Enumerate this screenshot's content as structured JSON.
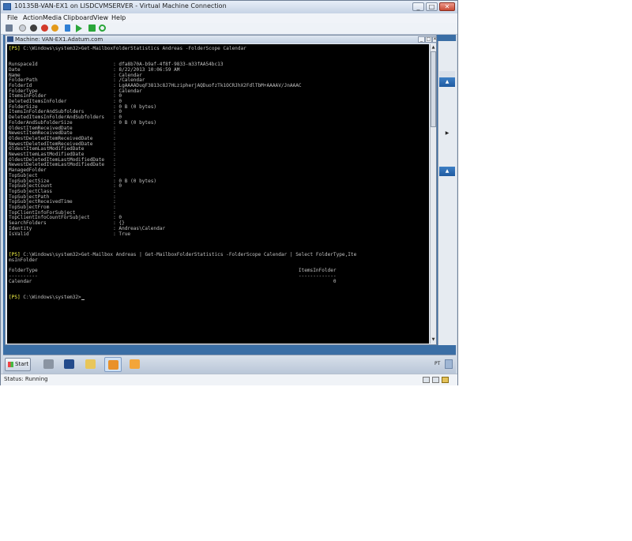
{
  "window": {
    "title": "10135B-VAN-EX1 on LISDCVMSERVER - Virtual Machine Connection",
    "controls": [
      "_",
      "□",
      "✕"
    ]
  },
  "menu": [
    "File",
    "Action",
    "Media",
    "Clipboard",
    "View",
    "Help"
  ],
  "toolbar_icons": [
    "ctrl-alt-del-icon",
    "start-icon",
    "turn-off-icon",
    "shutdown-icon",
    "save-icon",
    "pause-icon",
    "resume-icon",
    "checkpoint-icon",
    "revert-icon"
  ],
  "powershell_window": {
    "title": "Machine: VAN-EX1.Adatum.com",
    "controls": [
      "_",
      "□",
      "✕"
    ]
  },
  "console": {
    "lines": [
      {
        "prompt": "[PS]",
        "text": " C:\\Windows\\system32>Get-MailboxFolderStatistics Andreas -FolderScope Calendar"
      },
      {
        "text": ""
      },
      {
        "text": ""
      },
      {
        "text": "RunspaceId                          : dfa8b70A-b9af-4f8f-9833-m33fAA54bc13"
      },
      {
        "text": "Date                                : 8/22/2013 10:06:59 AM"
      },
      {
        "text": "Name                                : Calendar"
      },
      {
        "text": "FolderPath                          : /Calendar"
      },
      {
        "text": "FolderId                            : LgAAAADuqF3813c8J7HLzipherjAQDuofzTk1OCRJhX2FdlTbM+AAAAV/JnAAAC"
      },
      {
        "text": "FolderType                          : Calendar"
      },
      {
        "text": "ItemsInFolder                       : 0"
      },
      {
        "text": "DeletedItemsInFolder                : 0"
      },
      {
        "text": "FolderSize                          : 0 B (0 bytes)"
      },
      {
        "text": "ItemsInFolderAndSubfolders          : 0"
      },
      {
        "text": "DeletedItemsInFolderAndSubfolders   : 0"
      },
      {
        "text": "FolderAndSubfolderSize              : 0 B (0 bytes)"
      },
      {
        "text": "OldestItemReceivedDate              :"
      },
      {
        "text": "NewestItemReceivedDate              :"
      },
      {
        "text": "OldestDeletedItemReceivedDate       :"
      },
      {
        "text": "NewestDeletedItemReceivedDate       :"
      },
      {
        "text": "OldestItemLastModifiedDate          :"
      },
      {
        "text": "NewestItemLastModifiedDate          :"
      },
      {
        "text": "OldestDeletedItemLastModifiedDate   :"
      },
      {
        "text": "NewestDeletedItemLastModifiedDate   :"
      },
      {
        "text": "ManagedFolder                       :"
      },
      {
        "text": "TopSubject                          :"
      },
      {
        "text": "TopSubjectSize                      : 0 B (0 bytes)"
      },
      {
        "text": "TopSubjectCount                     : 0"
      },
      {
        "text": "TopSubjectClass                     :"
      },
      {
        "text": "TopSubjectPath                      :"
      },
      {
        "text": "TopSubjectReceivedTime              :"
      },
      {
        "text": "TopSubjectFrom                      :"
      },
      {
        "text": "TopClientInfoForSubject             :"
      },
      {
        "text": "TopClientInfoCountForSubject        : 0"
      },
      {
        "text": "SearchFolders                       : {}"
      },
      {
        "text": "Identity                            : Andreas\\Calendar"
      },
      {
        "text": "IsValid                             : True"
      },
      {
        "text": ""
      },
      {
        "text": ""
      },
      {
        "text": ""
      },
      {
        "prompt": "[PS]",
        "text": " C:\\Windows\\system32>Get-Mailbox Andreas | Get-MailboxFolderStatistics -FolderScope Calendar | Select FolderType,Ite"
      },
      {
        "text": "msInFolder"
      },
      {
        "text": ""
      },
      {
        "text": "FolderType                                                                                          ItemsInFolder"
      },
      {
        "text": "----------                                                                                          -------------"
      },
      {
        "text": "Calendar                                                                                                        0"
      },
      {
        "text": ""
      },
      {
        "text": ""
      },
      {
        "prompt": "[PS]",
        "text": " C:\\Windows\\system32>",
        "cursor": true
      }
    ]
  },
  "taskbar": {
    "start_label": "Start",
    "language": "PT",
    "tasks": [
      "server-manager-icon",
      "powershell-icon",
      "explorer-icon",
      "exchange-console-icon",
      "exchange-toolbox-icon"
    ]
  },
  "statusbar": {
    "text": "Status: Running"
  }
}
